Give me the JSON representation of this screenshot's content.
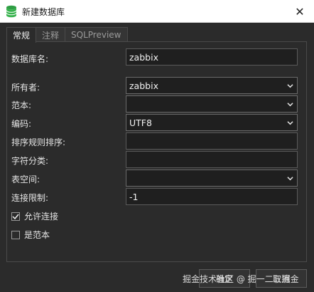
{
  "window": {
    "title": "新建数据库",
    "app_icon": "database-icon",
    "close_glyph": "✕"
  },
  "tabs": [
    {
      "label": "常规",
      "active": true
    },
    {
      "label": "注释",
      "active": false
    },
    {
      "label": "SQLPreview",
      "active": false
    }
  ],
  "form": {
    "db_name": {
      "label": "数据库名:",
      "value": "zabbix"
    },
    "owner": {
      "label": "所有者:",
      "value": "zabbix"
    },
    "template": {
      "label": "范本:",
      "value": ""
    },
    "encoding": {
      "label": "编码:",
      "value": "UTF8"
    },
    "collation": {
      "label": "排序规则排序:",
      "value": ""
    },
    "ctype": {
      "label": "字符分类:",
      "value": ""
    },
    "tablespace": {
      "label": "表空间:",
      "value": ""
    },
    "conn_limit": {
      "label": "连接限制:",
      "value": "-1"
    }
  },
  "checks": {
    "allow_conn": {
      "label": "允许连接",
      "checked": true
    },
    "is_template": {
      "label": "是范本",
      "checked": false
    }
  },
  "buttons": {
    "ok": "确定",
    "cancel": "取消"
  },
  "watermark": "掘金技术社区 @ 掘一二三掘金"
}
